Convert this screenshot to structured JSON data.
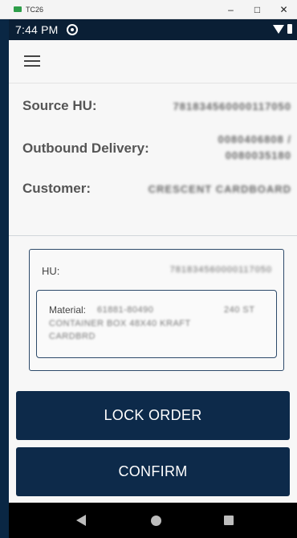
{
  "window": {
    "title": "TC26",
    "controls": {
      "minimize": "–",
      "maximize": "□",
      "close": "✕"
    }
  },
  "status_bar": {
    "time": "7:44 PM",
    "icons": [
      "sync-icon",
      "wifi-icon",
      "battery-icon"
    ]
  },
  "app_bar": {
    "menu_icon": "hamburger-menu-icon"
  },
  "info": {
    "source_hu": {
      "label": "Source HU:",
      "value": "781834560000117050"
    },
    "outbound_delivery": {
      "label": "Outbound Delivery:",
      "value_line1": "0080406808 /",
      "value_line2": "0080035180"
    },
    "customer": {
      "label": "Customer:",
      "value": "CRESCENT CARDBOARD"
    }
  },
  "hu_card": {
    "label": "HU:",
    "value": "781834560000117050",
    "material": {
      "label": "Material:",
      "code": "61881-80490",
      "qty": "240 ST",
      "desc_line1": "CONTAINER BOX 48X40 KRAFT",
      "desc_line2": "CARDBRD"
    }
  },
  "buttons": {
    "lock_order": "LOCK ORDER",
    "confirm": "CONFIRM"
  },
  "nav": {
    "back": "back-icon",
    "home": "home-icon",
    "recents": "recents-icon"
  }
}
